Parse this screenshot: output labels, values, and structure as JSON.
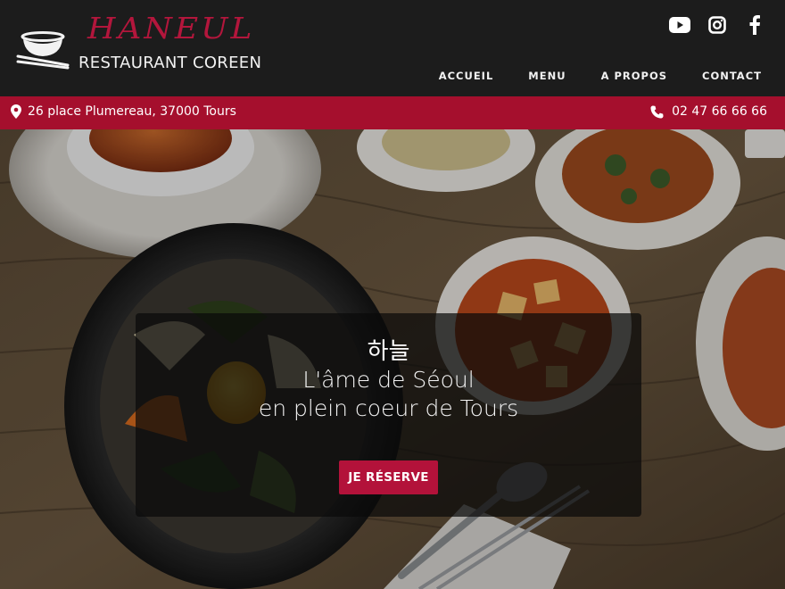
{
  "brand": {
    "name": "HANEUL",
    "subtitle": "RESTAURANT COREEN"
  },
  "socials": [
    {
      "icon": "youtube-icon"
    },
    {
      "icon": "instagram-icon"
    },
    {
      "icon": "facebook-icon"
    }
  ],
  "nav": {
    "items": [
      "ACCUEIL",
      "MENU",
      "A PROPOS",
      "CONTACT"
    ]
  },
  "infobar": {
    "address": "26 place Plumereau, 37000 Tours",
    "phone": "02 47 66 66 66"
  },
  "hero": {
    "korean": "하늘",
    "line1": "L'âme de Séoul",
    "line2": "en plein coeur de Tours",
    "cta_label": "JE RÉSERVE"
  },
  "colors": {
    "header_bg": "#1c1c1c",
    "accent": "#b3163c",
    "infobar_bg": "#a50f2d"
  }
}
